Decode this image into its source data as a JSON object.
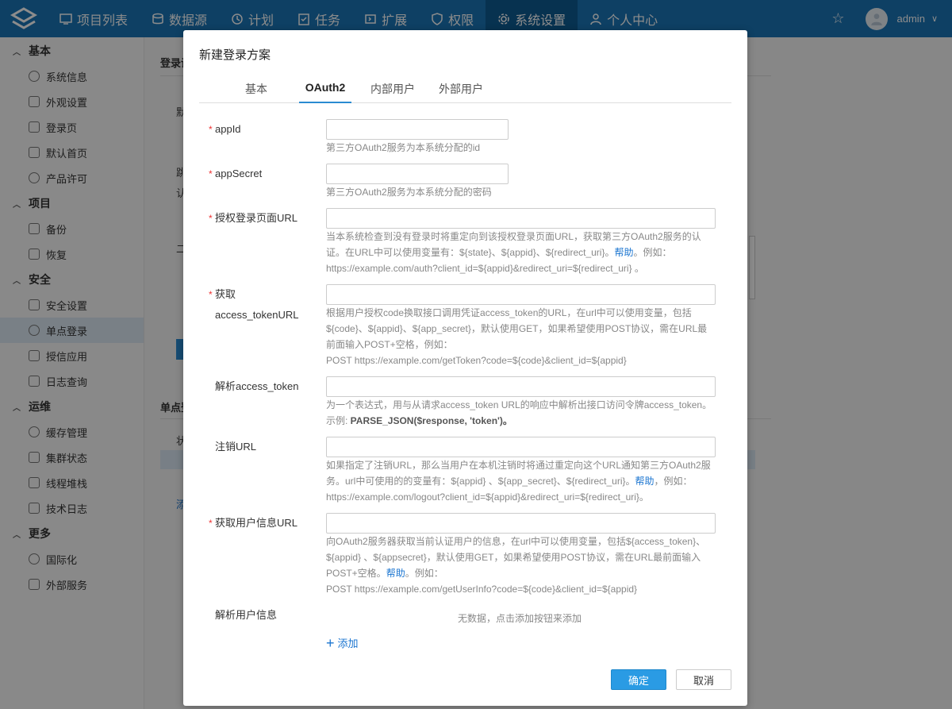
{
  "nav": {
    "items": [
      {
        "label": "项目列表",
        "icon": "monitor-icon"
      },
      {
        "label": "数据源",
        "icon": "database-icon"
      },
      {
        "label": "计划",
        "icon": "clock-icon"
      },
      {
        "label": "任务",
        "icon": "clipboard-icon"
      },
      {
        "label": "扩展",
        "icon": "extension-icon"
      },
      {
        "label": "权限",
        "icon": "shield-icon"
      },
      {
        "label": "系统设置",
        "icon": "gear-icon"
      },
      {
        "label": "个人中心",
        "icon": "user-icon"
      }
    ],
    "user": "admin"
  },
  "sidebar": {
    "groups": [
      {
        "label": "基本",
        "items": [
          "系统信息",
          "外观设置",
          "登录页",
          "默认首页",
          "产品许可"
        ]
      },
      {
        "label": "项目",
        "items": [
          "备份",
          "恢复"
        ]
      },
      {
        "label": "安全",
        "items": [
          "安全设置",
          "单点登录",
          "授信应用",
          "日志查询"
        ]
      },
      {
        "label": "运维",
        "items": [
          "缓存管理",
          "集群状态",
          "线程堆栈",
          "技术日志"
        ]
      },
      {
        "label": "更多",
        "items": [
          "国际化",
          "外部服务"
        ]
      }
    ]
  },
  "background": {
    "section_title": "登录设",
    "section2_title": "单点登",
    "frag_1": "默",
    "frag_2": "跳",
    "frag_3": "认",
    "frag_4": "二",
    "frag_5": "状",
    "frag_6": "添"
  },
  "modal": {
    "title": "新建登录方案",
    "tabs": [
      "基本",
      "OAuth2",
      "内部用户",
      "外部用户"
    ],
    "active_tab": "OAuth2",
    "fields": {
      "appid": {
        "label": "appId",
        "hint": "第三方OAuth2服务为本系统分配的id"
      },
      "appsecret": {
        "label": "appSecret",
        "hint": "第三方OAuth2服务为本系统分配的密码"
      },
      "auth_url": {
        "label": "授权登录页面URL",
        "hint_1": "当本系统检查到没有登录时将重定向到该授权登录页面URL，获取第三方OAuth2服务的认",
        "hint_2": "证。在URL中可以使用变量有：${state}、${appid}、${redirect_uri}。",
        "hint_link": "帮助",
        "hint_3": "。例如：",
        "hint_4": "https://example.com/auth?client_id=${appid}&redirect_uri=${redirect_uri} 。"
      },
      "token_url": {
        "label_1": "获取",
        "label_2": "access_tokenURL",
        "hint_1": "根据用户授权code换取接口调用凭证access_token的URL，在url中可以使用变量，包括",
        "hint_2": "${code}、${appid}、${app_secret}，默认使用GET，如果希望使用POST协议，需在URL最",
        "hint_3": "前面输入POST+空格，例如：",
        "hint_4": "POST https://example.com/getToken?code=${code}&client_id=${appid}"
      },
      "parse_token": {
        "label": "解析access_token",
        "hint_1": "为一个表达式，用与从请求access_token URL的响应中解析出接口访问令牌access_token。",
        "hint_2a": "示例: ",
        "hint_2b": "PARSE_JSON($response, 'token')",
        "hint_2c": "。"
      },
      "logout_url": {
        "label": "注销URL",
        "hint_1": "如果指定了注销URL，那么当用户在本机注销时将通过重定向这个URL通知第三方OAuth2服",
        "hint_2": "务。url中可使用的的变量有：${appid} 、${app_secret}、${redirect_uri}。",
        "hint_link": "帮助",
        "hint_3": "，例如：",
        "hint_4": "https://example.com/logout?client_id=${appid}&redirect_uri=${redirect_uri}。"
      },
      "userinfo_url": {
        "label": "获取用户信息URL",
        "hint_1": "向OAuth2服务器获取当前认证用户的信息，在url中可以使用变量，包括${access_token}、",
        "hint_2": "${appid} 、${appsecret}，默认使用GET，如果希望使用POST协议，需在URL最前面输入",
        "hint_3": "POST+空格。",
        "hint_link": "帮助",
        "hint_4": "。例如：",
        "hint_5": "POST https://example.com/getUserInfo?code=${code}&client_id=${appid}"
      },
      "parse_userinfo": {
        "label": "解析用户信息",
        "empty": "无数据，点击添加按钮来添加",
        "add": "添加"
      }
    },
    "ok": "确定",
    "cancel": "取消"
  }
}
